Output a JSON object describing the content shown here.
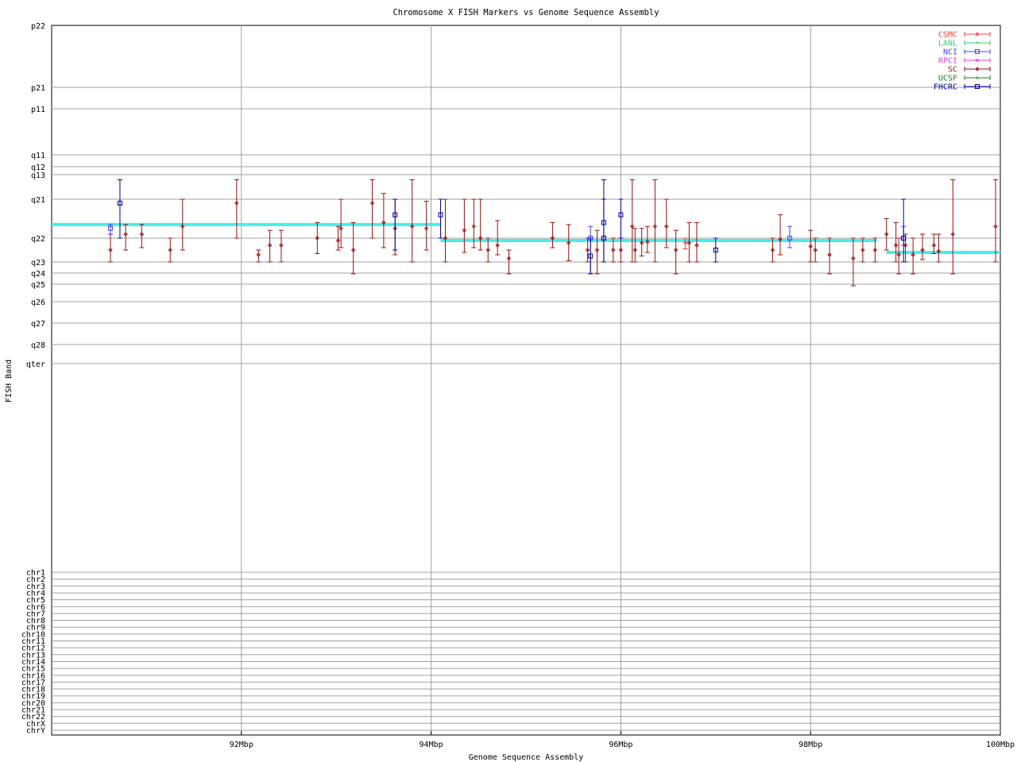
{
  "chart_data": {
    "type": "scatter",
    "title": "Chromosome X FISH Markers vs Genome Sequence Assembly",
    "xlabel": "Genome Sequence Assembly",
    "ylabel": "FISH Band",
    "xlim": [
      90,
      100
    ],
    "x_ticks": [
      {
        "value": 92,
        "label": "92Mbp"
      },
      {
        "value": 94,
        "label": "94Mbp"
      },
      {
        "value": 96,
        "label": "96Mbp"
      },
      {
        "value": 98,
        "label": "98Mbp"
      },
      {
        "value": 100,
        "label": "100Mbp"
      }
    ],
    "grid": true,
    "legend_position": "top-right",
    "band_ticks": [
      "p22",
      "p21",
      "p11",
      "q11",
      "q12",
      "q13",
      "q21",
      "q22",
      "q23",
      "q24",
      "q25",
      "q26",
      "q27",
      "q28",
      "qter"
    ],
    "chr_ticks": [
      "chr1",
      "chr2",
      "chr3",
      "chr4",
      "chr5",
      "chr6",
      "chr7",
      "chr8",
      "chr9",
      "chr10",
      "chr11",
      "chr12",
      "chr13",
      "chr14",
      "chr15",
      "chr16",
      "chr17",
      "chr18",
      "chr19",
      "chr20",
      "chr21",
      "chr22",
      "chrX",
      "chrY"
    ],
    "legend": [
      {
        "name": "CSMC",
        "color": "#ff4040",
        "marker": "diamond"
      },
      {
        "name": "LANL",
        "color": "#33cc66",
        "marker": "plus"
      },
      {
        "name": "NCI",
        "color": "#4444ff",
        "marker": "square"
      },
      {
        "name": "RPCI",
        "color": "#dd44dd",
        "marker": "cross"
      },
      {
        "name": "SC",
        "color": "#991111",
        "marker": "diamond"
      },
      {
        "name": "UCSF",
        "color": "#118811",
        "marker": "plus"
      },
      {
        "name": "FHCRC",
        "color": "#000099",
        "marker": "square"
      }
    ],
    "assembly_color": "#44eeee",
    "assembly_segments": [
      {
        "x1": 90.0,
        "x2": 94.1,
        "band": "q22",
        "offset": -0.35
      },
      {
        "x1": 94.1,
        "x2": 98.7,
        "band": "q22",
        "offset": 0.1
      },
      {
        "x1": 98.8,
        "x2": 100.0,
        "band": "q22",
        "offset": 0.6
      }
    ],
    "series": [
      {
        "name": "SC",
        "points": [
          {
            "x": 90.62,
            "y": 0.5,
            "lo": -0.1,
            "hi": 1.0
          },
          {
            "x": 90.78,
            "y": -0.1,
            "lo": -0.35,
            "hi": 0.5
          },
          {
            "x": 90.95,
            "y": -0.1,
            "lo": -0.35,
            "hi": 0.4
          },
          {
            "x": 91.25,
            "y": 0.5,
            "lo": 0.0,
            "hi": 1.0
          },
          {
            "x": 91.38,
            "y": -0.3,
            "lo": -1.0,
            "hi": 0.5
          },
          {
            "x": 91.95,
            "y": -0.9,
            "lo": -1.5,
            "hi": 0.0
          },
          {
            "x": 92.18,
            "y": 0.7,
            "lo": 0.5,
            "hi": 1.0
          },
          {
            "x": 92.3,
            "y": 0.3,
            "lo": -0.2,
            "hi": 1.0
          },
          {
            "x": 92.42,
            "y": 0.3,
            "lo": -0.2,
            "hi": 1.0
          },
          {
            "x": 92.8,
            "y": 0.0,
            "lo": -0.4,
            "hi": 0.65
          },
          {
            "x": 93.02,
            "y": 0.1,
            "lo": -0.3,
            "hi": 0.5
          },
          {
            "x": 93.05,
            "y": -0.25,
            "lo": -1.0,
            "hi": 0.4
          },
          {
            "x": 93.18,
            "y": 0.5,
            "lo": -0.4,
            "hi": 1.5
          },
          {
            "x": 93.38,
            "y": -0.9,
            "lo": -1.5,
            "hi": 0.0
          },
          {
            "x": 93.5,
            "y": -0.4,
            "lo": -1.15,
            "hi": 0.4
          },
          {
            "x": 93.62,
            "y": -0.25,
            "lo": -1.0,
            "hi": 0.7
          },
          {
            "x": 93.8,
            "y": -0.3,
            "lo": -1.5,
            "hi": 1.0
          },
          {
            "x": 93.95,
            "y": -0.25,
            "lo": -0.95,
            "hi": 0.5
          },
          {
            "x": 94.15,
            "y": 0.0,
            "lo": -1.0,
            "hi": 1.0
          },
          {
            "x": 94.35,
            "y": -0.2,
            "lo": -1.0,
            "hi": 0.6
          },
          {
            "x": 94.45,
            "y": -0.3,
            "lo": -1.0,
            "hi": 0.4
          },
          {
            "x": 94.52,
            "y": 0.0,
            "lo": -1.0,
            "hi": 0.5
          },
          {
            "x": 94.6,
            "y": 0.5,
            "lo": 0.0,
            "hi": 1.0
          },
          {
            "x": 94.7,
            "y": 0.3,
            "lo": -0.45,
            "hi": 0.7
          },
          {
            "x": 94.82,
            "y": 0.85,
            "lo": 0.5,
            "hi": 1.5
          },
          {
            "x": 95.28,
            "y": 0.0,
            "lo": -0.4,
            "hi": 0.4
          },
          {
            "x": 95.45,
            "y": 0.2,
            "lo": -0.35,
            "hi": 0.95
          },
          {
            "x": 95.65,
            "y": 0.5,
            "lo": 0.0,
            "hi": 1.0
          },
          {
            "x": 95.75,
            "y": 0.5,
            "lo": -0.2,
            "hi": 1.5
          },
          {
            "x": 95.92,
            "y": 0.5,
            "lo": 0.0,
            "hi": 1.0
          },
          {
            "x": 96.0,
            "y": 0.5,
            "lo": 0.0,
            "hi": 1.0
          },
          {
            "x": 96.12,
            "y": -0.3,
            "lo": -1.5,
            "hi": 1.0
          },
          {
            "x": 96.15,
            "y": 0.5,
            "lo": -0.25,
            "hi": 1.0
          },
          {
            "x": 96.22,
            "y": 0.2,
            "lo": -0.25,
            "hi": 0.75
          },
          {
            "x": 96.28,
            "y": 0.15,
            "lo": -0.3,
            "hi": 0.6
          },
          {
            "x": 96.36,
            "y": -0.3,
            "lo": -1.5,
            "hi": 1.0
          },
          {
            "x": 96.48,
            "y": -0.3,
            "lo": -1.0,
            "hi": 0.4
          },
          {
            "x": 96.58,
            "y": 0.5,
            "lo": -0.2,
            "hi": 1.5
          },
          {
            "x": 96.72,
            "y": 0.2,
            "lo": -0.4,
            "hi": 1.0
          },
          {
            "x": 96.8,
            "y": 0.3,
            "lo": -0.4,
            "hi": 1.0
          },
          {
            "x": 97.6,
            "y": 0.5,
            "lo": 0.0,
            "hi": 1.0
          },
          {
            "x": 97.68,
            "y": 0.05,
            "lo": -0.6,
            "hi": 0.7
          },
          {
            "x": 98.0,
            "y": 0.35,
            "lo": -0.2,
            "hi": 1.0
          },
          {
            "x": 98.05,
            "y": 0.5,
            "lo": 0.0,
            "hi": 1.0
          },
          {
            "x": 98.2,
            "y": 0.7,
            "lo": 0.0,
            "hi": 1.5
          },
          {
            "x": 98.45,
            "y": 0.85,
            "lo": 0.0,
            "hi": 2.0
          },
          {
            "x": 98.55,
            "y": 0.5,
            "lo": 0.0,
            "hi": 1.0
          },
          {
            "x": 98.68,
            "y": 0.5,
            "lo": 0.0,
            "hi": 1.0
          },
          {
            "x": 98.8,
            "y": -0.1,
            "lo": -0.5,
            "hi": 0.5
          },
          {
            "x": 98.9,
            "y": 0.3,
            "lo": -0.4,
            "hi": 1.0
          },
          {
            "x": 98.93,
            "y": 0.7,
            "lo": 0.0,
            "hi": 1.5
          },
          {
            "x": 99.0,
            "y": 0.3,
            "lo": -0.1,
            "hi": 1.0
          },
          {
            "x": 99.08,
            "y": 0.7,
            "lo": 0.0,
            "hi": 1.5
          },
          {
            "x": 99.18,
            "y": 0.5,
            "lo": -0.1,
            "hi": 0.9
          },
          {
            "x": 99.3,
            "y": 0.3,
            "lo": -0.1,
            "hi": 0.65
          },
          {
            "x": 99.35,
            "y": 0.55,
            "lo": -0.1,
            "hi": 1.0
          },
          {
            "x": 99.5,
            "y": -0.1,
            "lo": -1.5,
            "hi": 1.5
          },
          {
            "x": 99.95,
            "y": -0.3,
            "lo": -1.5,
            "hi": 1.0
          }
        ]
      },
      {
        "name": "NCI",
        "points": [
          {
            "x": 90.62,
            "y": -0.25,
            "lo": -0.35,
            "hi": -0.1
          },
          {
            "x": 95.68,
            "y": 0.0,
            "lo": -0.3,
            "hi": 1.5
          },
          {
            "x": 97.78,
            "y": 0.0,
            "lo": -0.3,
            "hi": 0.4
          },
          {
            "x": 98.98,
            "y": 0.0,
            "lo": -0.3,
            "hi": 0.3
          }
        ]
      },
      {
        "name": "CSMC",
        "points": [
          {
            "x": 96.68,
            "y": 0.2,
            "lo": 0.0,
            "hi": 0.45
          }
        ]
      },
      {
        "name": "FHCRC",
        "points": [
          {
            "x": 90.72,
            "y": -0.9,
            "lo": -1.5,
            "hi": 0.0
          },
          {
            "x": 93.62,
            "y": -0.6,
            "lo": -1.0,
            "hi": 0.5
          },
          {
            "x": 94.1,
            "y": -0.6,
            "lo": -1.0,
            "hi": 0.0
          },
          {
            "x": 95.68,
            "y": 0.75,
            "lo": 0.0,
            "hi": 1.5
          },
          {
            "x": 95.82,
            "y": 0.0,
            "lo": -1.0,
            "hi": 1.0
          },
          {
            "x": 95.82,
            "y": -0.4,
            "lo": -1.5,
            "hi": 1.0
          },
          {
            "x": 96.0,
            "y": -0.6,
            "lo": -1.0,
            "hi": 0.0
          },
          {
            "x": 97.0,
            "y": 0.5,
            "lo": 0.0,
            "hi": 1.0
          },
          {
            "x": 98.98,
            "y": 0.0,
            "lo": -1.0,
            "hi": 1.0
          }
        ]
      }
    ]
  }
}
